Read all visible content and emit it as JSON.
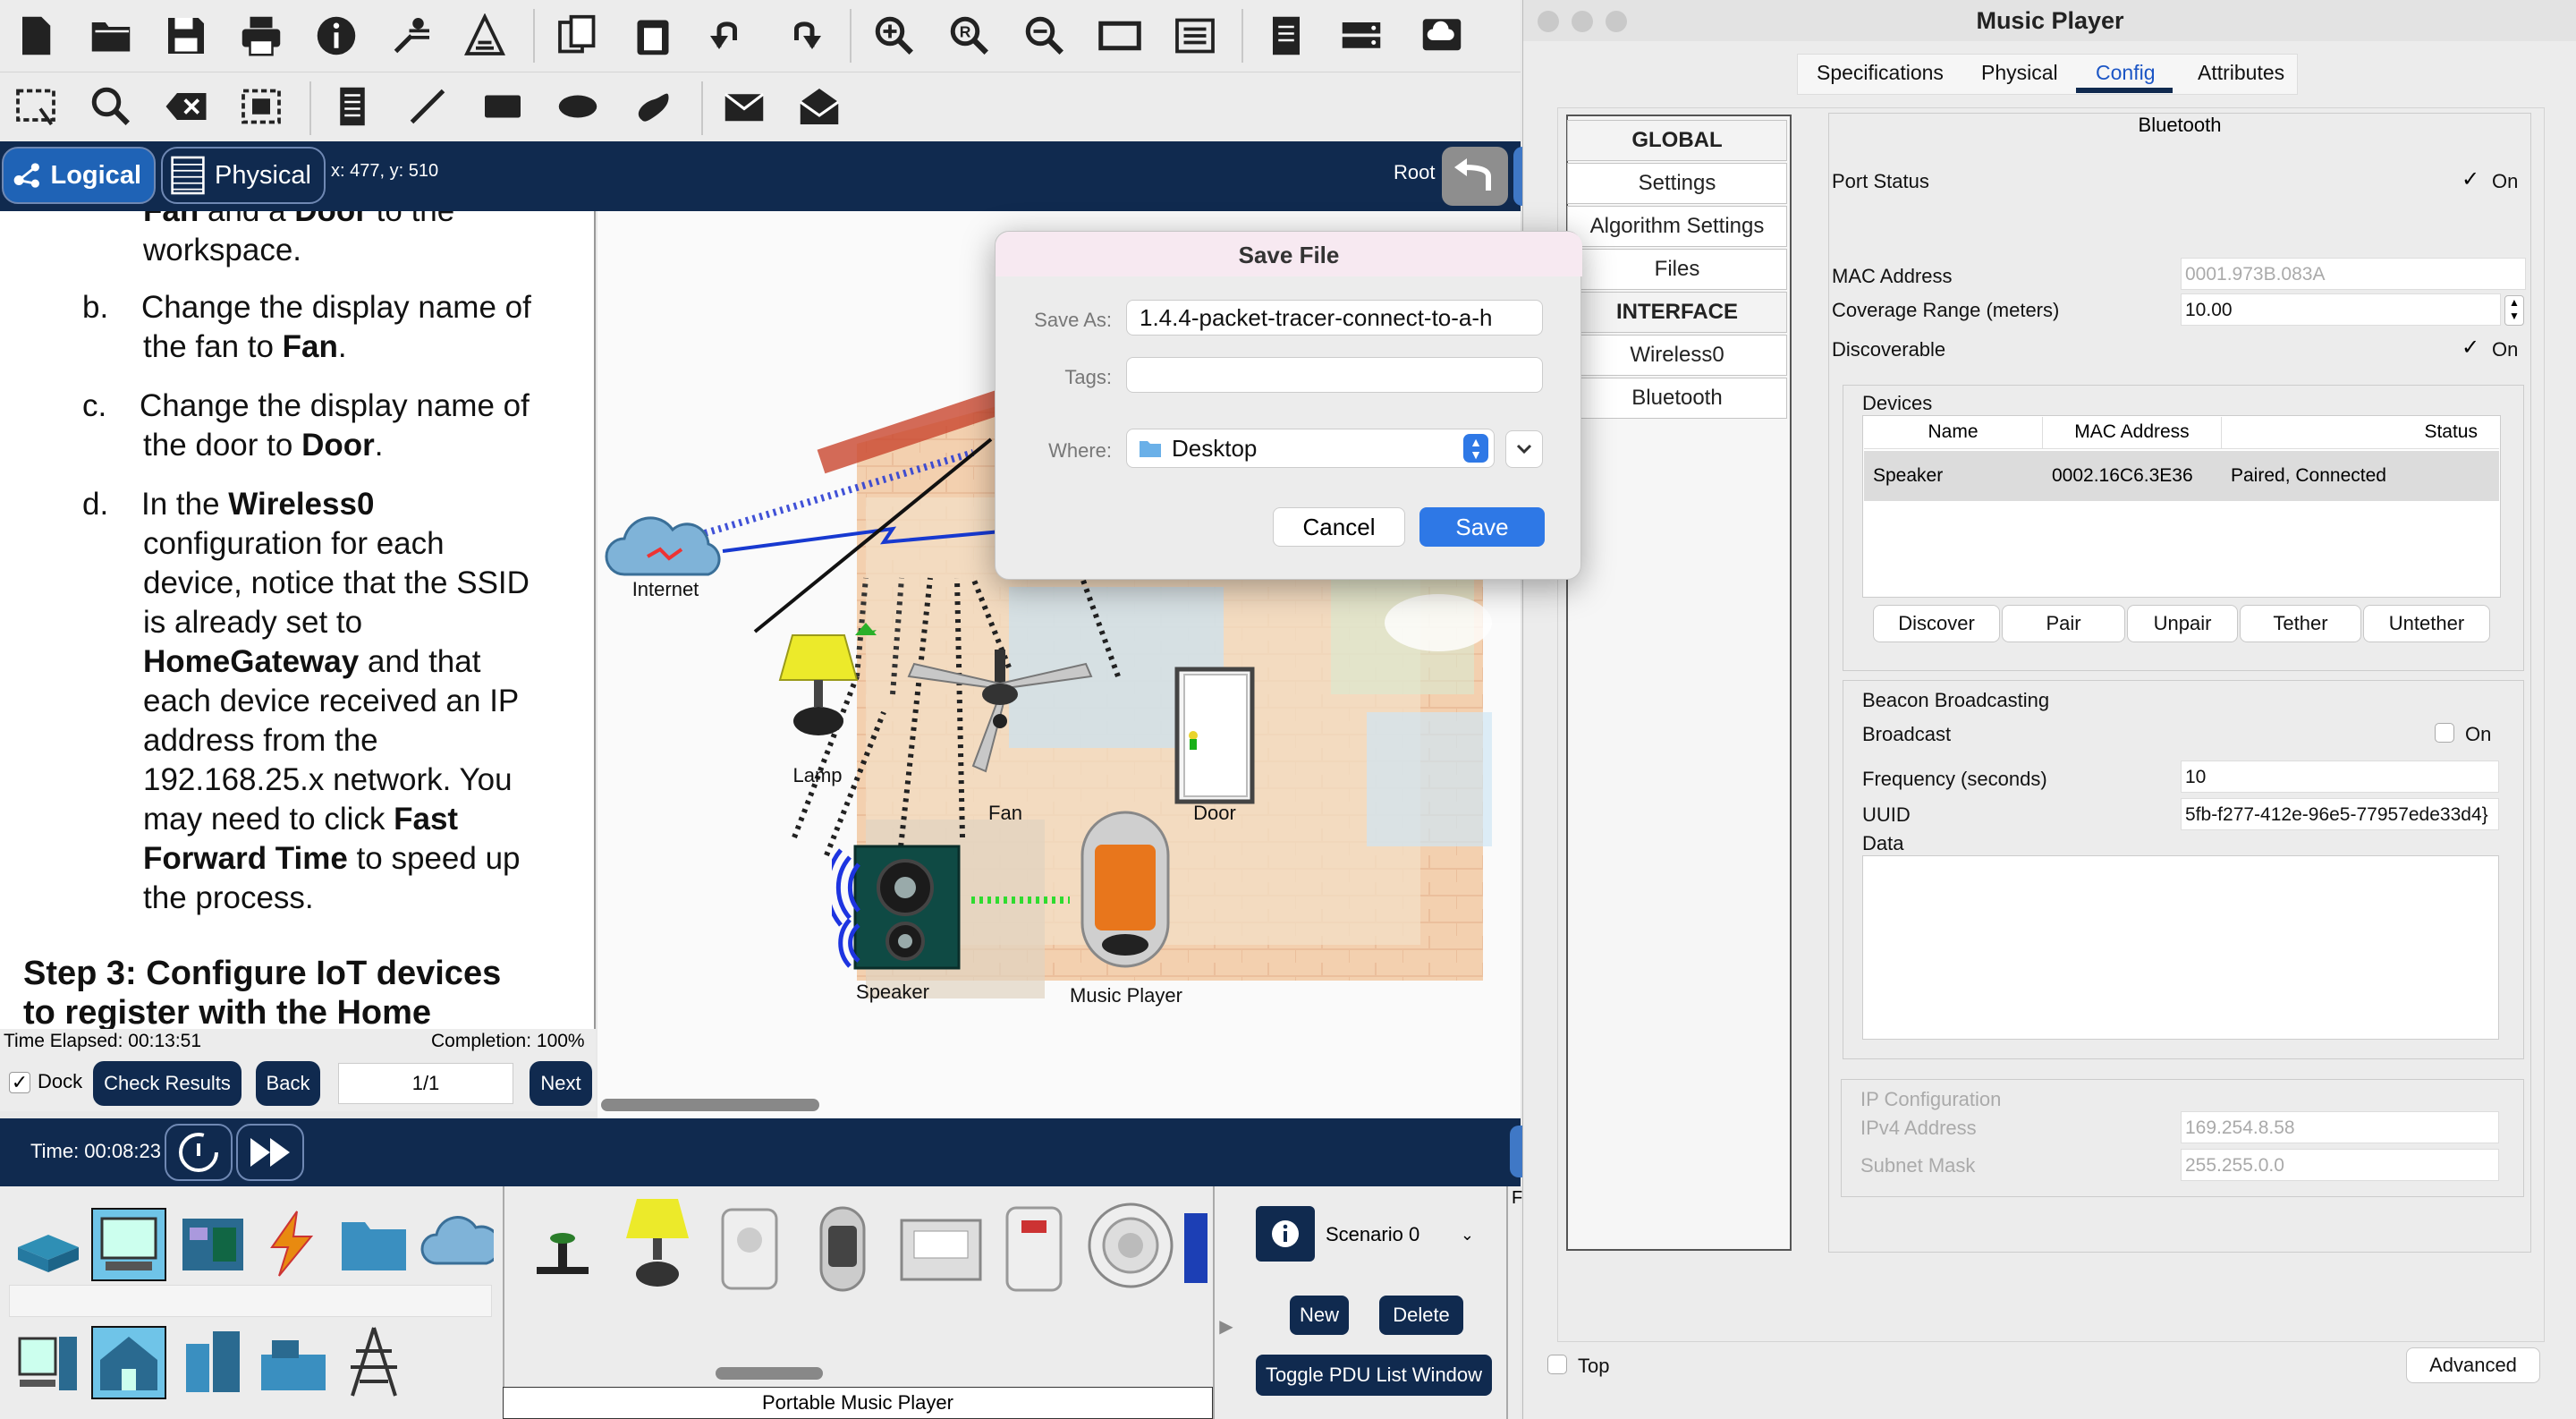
{
  "toolbar": {
    "position": "x: 477, y: 510",
    "root_label": "Root",
    "logical_label": "Logical",
    "physical_label": "Physical"
  },
  "instructions": {
    "cut_top": "Fan and a Door to the workspace.",
    "items": [
      {
        "letter": "b.",
        "line1": "Change the display name of",
        "line2a": "the fan to ",
        "line2b": "Fan",
        "line2c": "."
      },
      {
        "letter": "c.",
        "line1": "Change the display name of",
        "line2a": "the door to ",
        "line2b": "Door",
        "line2c": "."
      }
    ],
    "d_letter": "d.",
    "d_in_the": "In the ",
    "d_wireless": "Wireless0",
    "d_l2": "configuration for each",
    "d_l3": "device, notice that the SSID",
    "d_l4": "is already set to",
    "d_l5a": "HomeGateway",
    "d_l5b": " and that",
    "d_l6": "each device received an IP",
    "d_l7": "address from the",
    "d_l8": "192.168.25.x network. You",
    "d_l9a": "may need to click ",
    "d_l9b": "Fast",
    "d_l10a": "Forward Time",
    "d_l10b": " to speed up",
    "d_l11": "the process.",
    "step3": "Step 3: Configure IoT devices",
    "step3_cut": "to register with the Home",
    "time_elapsed": "Time Elapsed: 00:13:51",
    "completion": "Completion: 100%",
    "dock": "Dock",
    "check_results": "Check Results",
    "back": "Back",
    "page": "1/1",
    "next": "Next"
  },
  "canvas": {
    "internet": "Internet",
    "lamp": "Lamp",
    "fan": "Fan",
    "door": "Door",
    "speaker": "Speaker",
    "music_player": "Music Player"
  },
  "timebar": {
    "time": "Time: 00:08:23"
  },
  "bottom": {
    "device_caption": "Portable Music Player",
    "scenario": "Scenario 0",
    "new": "New",
    "delete": "Delete",
    "toggle_pdu": "Toggle PDU List Window",
    "f_label": "F"
  },
  "dialog": {
    "title": "Save File",
    "save_as_label": "Save As:",
    "save_as_value": "1.4.4-packet-tracer-connect-to-a-h",
    "tags_label": "Tags:",
    "where_label": "Where:",
    "where_value": "Desktop",
    "cancel": "Cancel",
    "save": "Save"
  },
  "music_player": {
    "title": "Music Player",
    "tabs": [
      "Specifications",
      "Physical",
      "Config",
      "Attributes"
    ],
    "active_tab": "Config",
    "sidebar": {
      "global": "GLOBAL",
      "settings": "Settings",
      "algorithm": "Algorithm Settings",
      "files": "Files",
      "interface": "INTERFACE",
      "wireless0": "Wireless0",
      "bluetooth": "Bluetooth"
    },
    "panel_title": "Bluetooth",
    "port_status": "Port Status",
    "on": "On",
    "mac_label": "MAC Address",
    "mac_value": "0001.973B.083A",
    "coverage_label": "Coverage Range (meters)",
    "coverage_value": "10.00",
    "discoverable": "Discoverable",
    "devices_label": "Devices",
    "columns": [
      "Name",
      "MAC Address",
      "Status"
    ],
    "rows": [
      {
        "name": "Speaker",
        "mac": "0002.16C6.3E36",
        "status": "Paired, Connected"
      }
    ],
    "buttons": [
      "Discover",
      "Pair",
      "Unpair",
      "Tether",
      "Untether"
    ],
    "beacon_label": "Beacon Broadcasting",
    "broadcast": "Broadcast",
    "frequency_label": "Frequency (seconds)",
    "frequency_value": "10",
    "uuid_label": "UUID",
    "uuid_value": "5fb-f277-412e-96e5-77957ede33d4}",
    "data_label": "Data",
    "ip_config": "IP Configuration",
    "ipv4_label": "IPv4 Address",
    "ipv4_value": "169.254.8.58",
    "subnet_label": "Subnet Mask",
    "subnet_value": "255.255.0.0",
    "top": "Top",
    "advanced": "Advanced"
  }
}
